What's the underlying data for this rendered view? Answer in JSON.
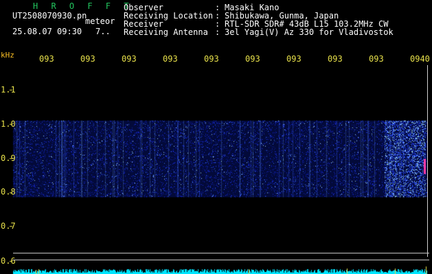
{
  "header": {
    "app_title": "H R O F F T",
    "filename": "UT2508070930.pn",
    "meteor_label": "meteor",
    "datetime": "25.08.07 09:30",
    "count": "7.."
  },
  "info": [
    {
      "label": "Observer",
      "value": "Masaki Kano"
    },
    {
      "label": "Receiving Location",
      "value": "Shibukawa, Gunma, Japan"
    },
    {
      "label": "Receiver",
      "value": "RTL-SDR SDR# 43dB L15 103.2MHz CW"
    },
    {
      "label": "Receiving Antenna",
      "value": "3el Yagi(V) Az 330 for Vladivostok"
    }
  ],
  "axis": {
    "unit": "kHz",
    "x_ticks": [
      "093",
      "093",
      "093",
      "093",
      "093",
      "093",
      "093",
      "093",
      "093",
      "0940"
    ],
    "y_ticks": [
      "1.1",
      "1.0",
      "0.9",
      "0.8",
      "0.7",
      "0.6"
    ]
  },
  "colors": {
    "spectrum_blue": "#1a2ad6",
    "tick_yellow": "#e7e04a",
    "title_green": "#22c55e",
    "baseline_cyan": "#00e5ff"
  }
}
